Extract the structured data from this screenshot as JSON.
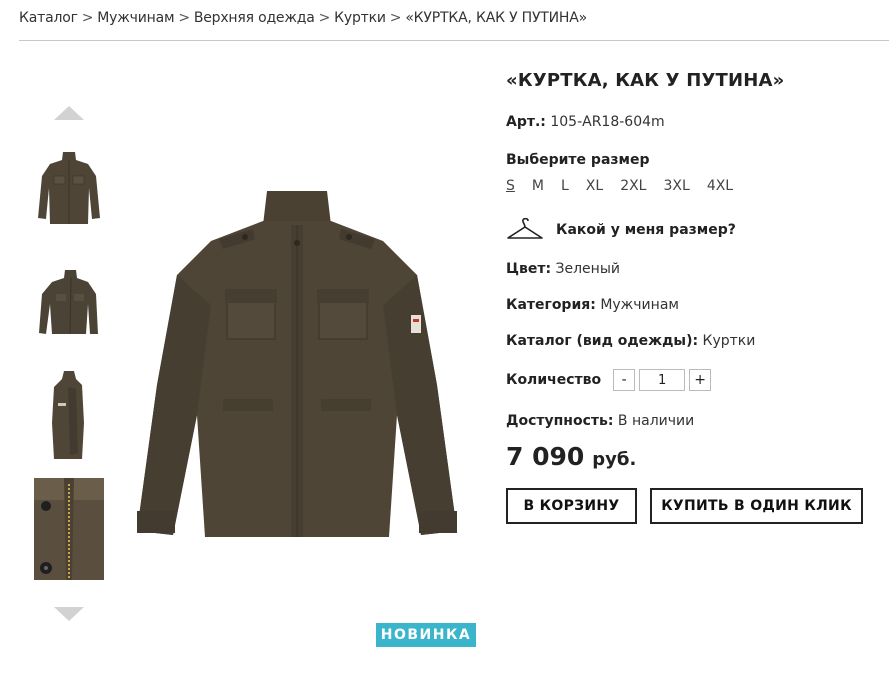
{
  "breadcrumb": {
    "items": [
      "Каталог",
      "Мужчинам",
      "Верхняя одежда",
      "Куртки",
      "«КУРТКА, КАК У ПУТИНА»"
    ],
    "separator": ">"
  },
  "gallery": {
    "up_arrow_icon": "chevron-up-icon",
    "down_arrow_icon": "chevron-down-icon",
    "badge": "НОВИНКА"
  },
  "product": {
    "title": "«КУРТКА, КАК У ПУТИНА»",
    "article_label": "Арт.:",
    "article_value": "105-AR18-604m",
    "size_title": "Выберите размер",
    "sizes": [
      "S",
      "M",
      "L",
      "XL",
      "2XL",
      "3XL",
      "4XL"
    ],
    "selected_size": "S",
    "size_help": "Какой у меня размер?",
    "color_label": "Цвет:",
    "color_value": "Зеленый",
    "category_label": "Категория:",
    "category_value": "Мужчинам",
    "catalog_label": "Каталог (вид одежды):",
    "catalog_value": "Куртки",
    "qty_label": "Количество",
    "qty_minus": "-",
    "qty_value": "1",
    "qty_plus": "+",
    "availability_label": "Доступность:",
    "availability_value": "В наличии",
    "price": "7 090",
    "currency": "руб.",
    "btn_cart": "В КОРЗИНУ",
    "btn_oneclick": "КУПИТЬ В ОДИН КЛИК"
  },
  "colors": {
    "jacket": "#4e4537",
    "badge": "#3bb5cc"
  }
}
